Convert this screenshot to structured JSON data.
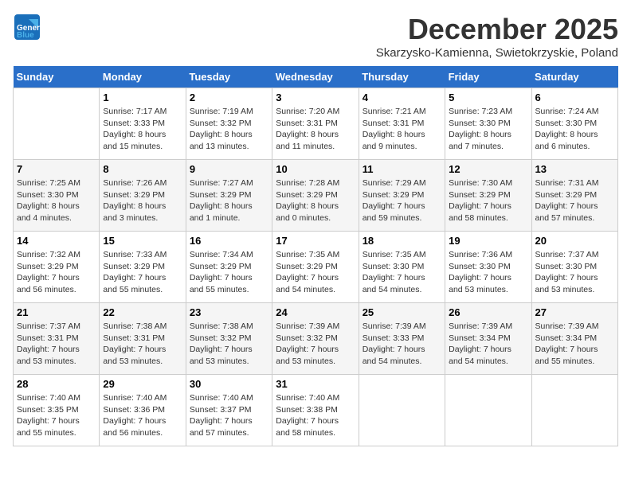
{
  "header": {
    "logo_line1": "General",
    "logo_line2": "Blue",
    "month_year": "December 2025",
    "location": "Skarzysko-Kamienna, Swietokrzyskie, Poland"
  },
  "weekdays": [
    "Sunday",
    "Monday",
    "Tuesday",
    "Wednesday",
    "Thursday",
    "Friday",
    "Saturday"
  ],
  "weeks": [
    [
      {
        "day": "",
        "info": ""
      },
      {
        "day": "1",
        "info": "Sunrise: 7:17 AM\nSunset: 3:33 PM\nDaylight: 8 hours\nand 15 minutes."
      },
      {
        "day": "2",
        "info": "Sunrise: 7:19 AM\nSunset: 3:32 PM\nDaylight: 8 hours\nand 13 minutes."
      },
      {
        "day": "3",
        "info": "Sunrise: 7:20 AM\nSunset: 3:31 PM\nDaylight: 8 hours\nand 11 minutes."
      },
      {
        "day": "4",
        "info": "Sunrise: 7:21 AM\nSunset: 3:31 PM\nDaylight: 8 hours\nand 9 minutes."
      },
      {
        "day": "5",
        "info": "Sunrise: 7:23 AM\nSunset: 3:30 PM\nDaylight: 8 hours\nand 7 minutes."
      },
      {
        "day": "6",
        "info": "Sunrise: 7:24 AM\nSunset: 3:30 PM\nDaylight: 8 hours\nand 6 minutes."
      }
    ],
    [
      {
        "day": "7",
        "info": "Sunrise: 7:25 AM\nSunset: 3:30 PM\nDaylight: 8 hours\nand 4 minutes."
      },
      {
        "day": "8",
        "info": "Sunrise: 7:26 AM\nSunset: 3:29 PM\nDaylight: 8 hours\nand 3 minutes."
      },
      {
        "day": "9",
        "info": "Sunrise: 7:27 AM\nSunset: 3:29 PM\nDaylight: 8 hours\nand 1 minute."
      },
      {
        "day": "10",
        "info": "Sunrise: 7:28 AM\nSunset: 3:29 PM\nDaylight: 8 hours\nand 0 minutes."
      },
      {
        "day": "11",
        "info": "Sunrise: 7:29 AM\nSunset: 3:29 PM\nDaylight: 7 hours\nand 59 minutes."
      },
      {
        "day": "12",
        "info": "Sunrise: 7:30 AM\nSunset: 3:29 PM\nDaylight: 7 hours\nand 58 minutes."
      },
      {
        "day": "13",
        "info": "Sunrise: 7:31 AM\nSunset: 3:29 PM\nDaylight: 7 hours\nand 57 minutes."
      }
    ],
    [
      {
        "day": "14",
        "info": "Sunrise: 7:32 AM\nSunset: 3:29 PM\nDaylight: 7 hours\nand 56 minutes."
      },
      {
        "day": "15",
        "info": "Sunrise: 7:33 AM\nSunset: 3:29 PM\nDaylight: 7 hours\nand 55 minutes."
      },
      {
        "day": "16",
        "info": "Sunrise: 7:34 AM\nSunset: 3:29 PM\nDaylight: 7 hours\nand 55 minutes."
      },
      {
        "day": "17",
        "info": "Sunrise: 7:35 AM\nSunset: 3:29 PM\nDaylight: 7 hours\nand 54 minutes."
      },
      {
        "day": "18",
        "info": "Sunrise: 7:35 AM\nSunset: 3:30 PM\nDaylight: 7 hours\nand 54 minutes."
      },
      {
        "day": "19",
        "info": "Sunrise: 7:36 AM\nSunset: 3:30 PM\nDaylight: 7 hours\nand 53 minutes."
      },
      {
        "day": "20",
        "info": "Sunrise: 7:37 AM\nSunset: 3:30 PM\nDaylight: 7 hours\nand 53 minutes."
      }
    ],
    [
      {
        "day": "21",
        "info": "Sunrise: 7:37 AM\nSunset: 3:31 PM\nDaylight: 7 hours\nand 53 minutes."
      },
      {
        "day": "22",
        "info": "Sunrise: 7:38 AM\nSunset: 3:31 PM\nDaylight: 7 hours\nand 53 minutes."
      },
      {
        "day": "23",
        "info": "Sunrise: 7:38 AM\nSunset: 3:32 PM\nDaylight: 7 hours\nand 53 minutes."
      },
      {
        "day": "24",
        "info": "Sunrise: 7:39 AM\nSunset: 3:32 PM\nDaylight: 7 hours\nand 53 minutes."
      },
      {
        "day": "25",
        "info": "Sunrise: 7:39 AM\nSunset: 3:33 PM\nDaylight: 7 hours\nand 54 minutes."
      },
      {
        "day": "26",
        "info": "Sunrise: 7:39 AM\nSunset: 3:34 PM\nDaylight: 7 hours\nand 54 minutes."
      },
      {
        "day": "27",
        "info": "Sunrise: 7:39 AM\nSunset: 3:34 PM\nDaylight: 7 hours\nand 55 minutes."
      }
    ],
    [
      {
        "day": "28",
        "info": "Sunrise: 7:40 AM\nSunset: 3:35 PM\nDaylight: 7 hours\nand 55 minutes."
      },
      {
        "day": "29",
        "info": "Sunrise: 7:40 AM\nSunset: 3:36 PM\nDaylight: 7 hours\nand 56 minutes."
      },
      {
        "day": "30",
        "info": "Sunrise: 7:40 AM\nSunset: 3:37 PM\nDaylight: 7 hours\nand 57 minutes."
      },
      {
        "day": "31",
        "info": "Sunrise: 7:40 AM\nSunset: 3:38 PM\nDaylight: 7 hours\nand 58 minutes."
      },
      {
        "day": "",
        "info": ""
      },
      {
        "day": "",
        "info": ""
      },
      {
        "day": "",
        "info": ""
      }
    ]
  ]
}
